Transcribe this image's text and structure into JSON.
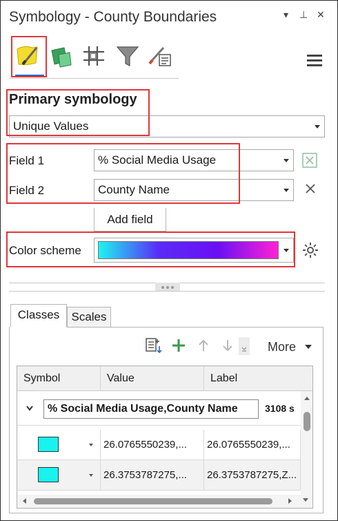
{
  "window": {
    "title": "Symbology - County Boundaries",
    "controls": {
      "menu": "▾",
      "pin": "⊥",
      "close": "✕"
    }
  },
  "tabs": [
    {
      "icon": "primary-symbology-brush-icon",
      "selected": true
    },
    {
      "icon": "vary-symbology-icon"
    },
    {
      "icon": "symbol-layer-drawing-icon"
    },
    {
      "icon": "filter-icon"
    },
    {
      "icon": "label-brush-icon"
    }
  ],
  "primary": {
    "heading": "Primary symbology",
    "method": "Unique Values"
  },
  "fields": {
    "field1_label": "Field 1",
    "field1_value": "% Social Media Usage",
    "field2_label": "Field 2",
    "field2_value": "County Name",
    "add_field": "Add field"
  },
  "color_scheme": {
    "label": "Color scheme",
    "gradient": [
      "#1ef4f0",
      "#5a2cf6",
      "#6a10f3",
      "#ff22d4"
    ]
  },
  "classes_tabs": {
    "classes": "Classes",
    "scales": "Scales"
  },
  "toolbar": {
    "more": "More"
  },
  "table": {
    "headers": {
      "symbol": "Symbol",
      "value": "Value",
      "label": "Label"
    },
    "group": {
      "label": "% Social Media Usage,County Name",
      "count": "3108 s"
    },
    "rows": [
      {
        "value": "26.0765550239,...",
        "label": "26.0765550239,...",
        "color": "#19f3f0"
      },
      {
        "value": "26.3753787275,...",
        "label": "26.3753787275,Z...",
        "color": "#19f3f0"
      }
    ]
  }
}
